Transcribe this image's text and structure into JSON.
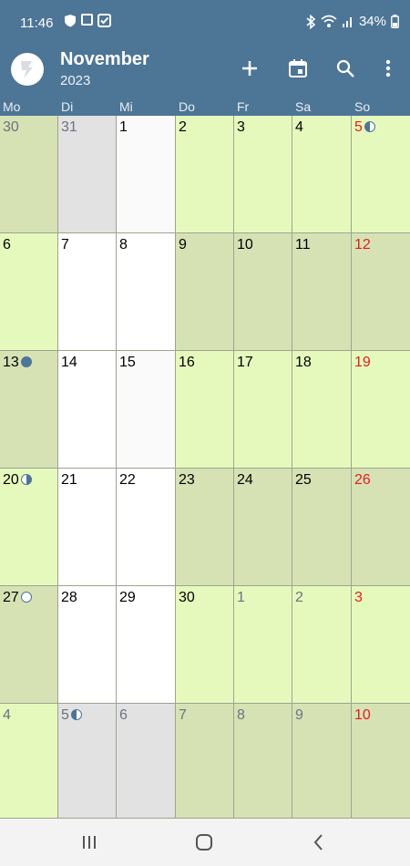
{
  "status": {
    "time": "11:46",
    "battery": "34%"
  },
  "header": {
    "month": "November",
    "year": "2023",
    "actions": [
      "add-icon",
      "calendar-today-icon",
      "search-icon",
      "more-vert-icon"
    ]
  },
  "weekdays": [
    "Mo",
    "Di",
    "Mi",
    "Do",
    "Fr",
    "Sa",
    "So"
  ],
  "colors": {
    "bar": "#4d7596",
    "green_light": "#e6f9bd",
    "green_dark": "#d6e2b4",
    "white": "#ffffff",
    "grey": "#e2e2e2",
    "today_bg": "#fafafa",
    "sunday": "#e02020"
  },
  "weeks": [
    [
      {
        "d": "30",
        "o": true,
        "bg": "green_dark"
      },
      {
        "d": "31",
        "o": true,
        "bg": "grey"
      },
      {
        "d": "1",
        "bg": "today_bg"
      },
      {
        "d": "2",
        "bg": "green_light"
      },
      {
        "d": "3",
        "bg": "green_light"
      },
      {
        "d": "4",
        "bg": "green_light"
      },
      {
        "d": "5",
        "bg": "green_light",
        "sun": true,
        "moon": "last"
      }
    ],
    [
      {
        "d": "6",
        "bg": "green_light"
      },
      {
        "d": "7",
        "bg": "white"
      },
      {
        "d": "8",
        "bg": "white"
      },
      {
        "d": "9",
        "bg": "green_dark"
      },
      {
        "d": "10",
        "bg": "green_dark"
      },
      {
        "d": "11",
        "bg": "green_dark"
      },
      {
        "d": "12",
        "bg": "green_dark",
        "sun": true
      }
    ],
    [
      {
        "d": "13",
        "bg": "green_dark",
        "moon": "new"
      },
      {
        "d": "14",
        "bg": "white"
      },
      {
        "d": "15",
        "bg": "today_bg"
      },
      {
        "d": "16",
        "bg": "green_light"
      },
      {
        "d": "17",
        "bg": "green_light"
      },
      {
        "d": "18",
        "bg": "green_light"
      },
      {
        "d": "19",
        "bg": "green_light",
        "sun": true
      }
    ],
    [
      {
        "d": "20",
        "bg": "green_light",
        "moon": "first"
      },
      {
        "d": "21",
        "bg": "white"
      },
      {
        "d": "22",
        "bg": "white"
      },
      {
        "d": "23",
        "bg": "green_dark"
      },
      {
        "d": "24",
        "bg": "green_dark"
      },
      {
        "d": "25",
        "bg": "green_dark"
      },
      {
        "d": "26",
        "bg": "green_dark",
        "sun": true
      }
    ],
    [
      {
        "d": "27",
        "bg": "green_dark",
        "moon": "full"
      },
      {
        "d": "28",
        "bg": "white"
      },
      {
        "d": "29",
        "bg": "white"
      },
      {
        "d": "30",
        "bg": "green_light"
      },
      {
        "d": "1",
        "o": true,
        "bg": "green_light"
      },
      {
        "d": "2",
        "o": true,
        "bg": "green_light"
      },
      {
        "d": "3",
        "o": true,
        "bg": "green_light",
        "sun": true
      }
    ],
    [
      {
        "d": "4",
        "o": true,
        "bg": "green_light"
      },
      {
        "d": "5",
        "o": true,
        "bg": "grey",
        "moon": "last"
      },
      {
        "d": "6",
        "o": true,
        "bg": "grey"
      },
      {
        "d": "7",
        "o": true,
        "bg": "green_dark"
      },
      {
        "d": "8",
        "o": true,
        "bg": "green_dark"
      },
      {
        "d": "9",
        "o": true,
        "bg": "green_dark"
      },
      {
        "d": "10",
        "o": true,
        "bg": "green_dark",
        "sun": true
      }
    ]
  ]
}
